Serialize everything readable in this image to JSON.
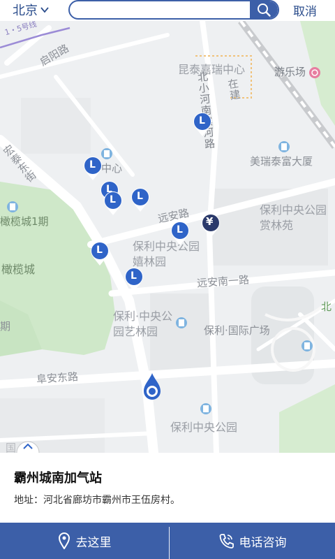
{
  "header": {
    "city": "北京",
    "search_placeholder": "",
    "cancel_label": "取消"
  },
  "map": {
    "labels": {
      "road_route": "1・5号线",
      "qiyang_road": "启阳路",
      "kuntai": "昆泰嘉瑞中心",
      "amusement": "游乐场",
      "under_construction": "在建",
      "beixiaohe": "北小河南滨河路",
      "hongtai_east": "宏泰东街",
      "center": "中心",
      "meiruitai": "美瑞泰富大厦",
      "poly_shanglin": "保利中央公园赏林苑",
      "ganlan_1": "橄榄城1期",
      "yuanan_road": "远安路",
      "poly_xilin": "保利中央公园嬉林园",
      "ganlan": "橄榄城",
      "yuanan_south1": "远安南一路",
      "north_edge": "北",
      "qi": "期",
      "poly_yilin": "保利·中央公园艺林园",
      "poly_plaza": "保利·国际广场",
      "fuan_east": "阜安东路",
      "poly_park": "保利中央公园",
      "bottom_fragment": "国  京"
    },
    "pin_letter": "L",
    "bank_symbol": "¥"
  },
  "station": {
    "name": "霸州城南加气站",
    "address": "地址：河北省廊坊市霸州市王伍房村。"
  },
  "actions": {
    "navigate_label": "去这里",
    "call_label": "电话咨询"
  },
  "colors": {
    "brand": "#3c5fa8",
    "pin": "#2f64c8",
    "bank_pin": "#2b3a6b",
    "park": "#cfe8c9"
  }
}
